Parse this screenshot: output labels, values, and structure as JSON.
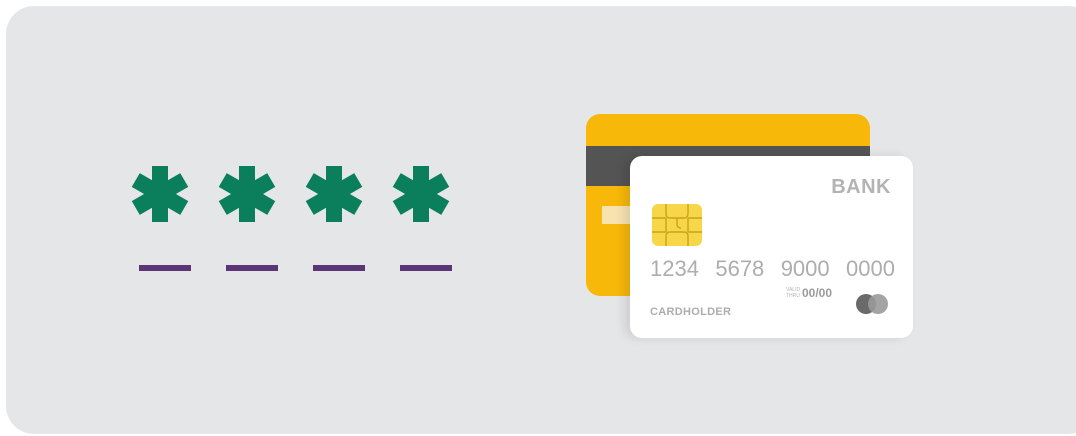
{
  "pin": {
    "slots": [
      {
        "icon": "asterisk-icon"
      },
      {
        "icon": "asterisk-icon"
      },
      {
        "icon": "asterisk-icon"
      },
      {
        "icon": "asterisk-icon"
      }
    ],
    "colors": {
      "asterisk": "#0b7f5c",
      "underline": "#5c3576"
    }
  },
  "card": {
    "bank_name": "BANK",
    "number_groups": [
      "1234",
      "5678",
      "9000",
      "0000"
    ],
    "valid_label_line1": "VALID",
    "valid_label_line2": "THRU",
    "valid_date": "00/00",
    "cardholder": "CARDHOLDER",
    "colors": {
      "back_card": "#f7b80a",
      "stripe": "#545454",
      "front_card": "#ffffff",
      "chip": "#f7d649",
      "text": "#adadad"
    }
  },
  "background": {
    "panel_color": "#e5e6e8"
  }
}
